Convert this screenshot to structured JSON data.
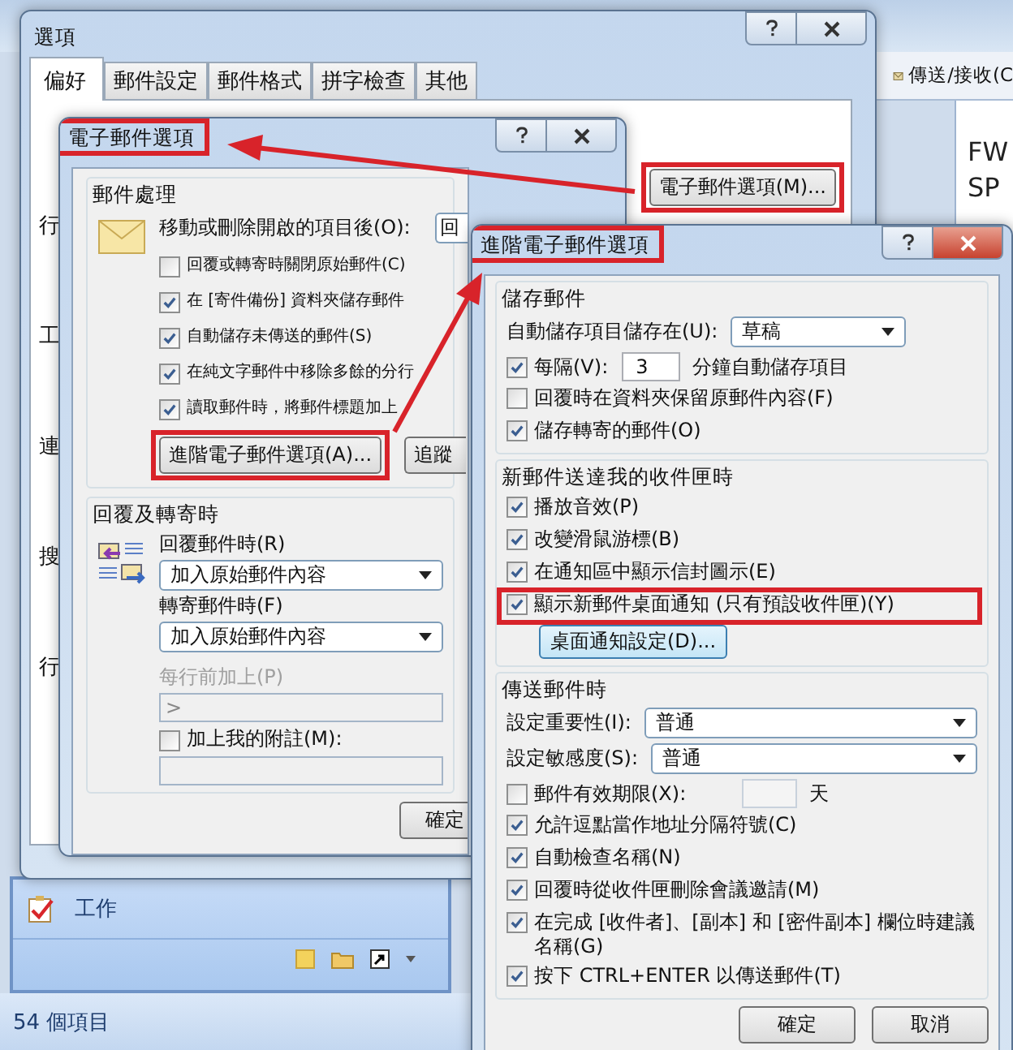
{
  "outlook": {
    "toolbar_button": "傳送/接收(C",
    "preview_lines": [
      "FW",
      "SP"
    ],
    "nav_item": "工作",
    "status_bar": "54 個項目"
  },
  "options_window": {
    "title": "選項",
    "tabs": [
      {
        "label": "偏好",
        "selected": true
      },
      {
        "label": "郵件設定",
        "selected": false
      },
      {
        "label": "郵件格式",
        "selected": false
      },
      {
        "label": "拼字檢查",
        "selected": false
      },
      {
        "label": "其他",
        "selected": false
      }
    ],
    "cut_labels": [
      "行",
      "工",
      "連",
      "搜",
      "行"
    ],
    "email_options_button": {
      "label": "電子郵件選項(M)...",
      "highlighted": true
    }
  },
  "email_options": {
    "title": {
      "text": "電子郵件選項",
      "highlighted": true
    },
    "handling": {
      "heading": "郵件處理",
      "move_label": "移動或刪除開啟的項目後(O):",
      "move_value": "回",
      "checkboxes": [
        {
          "label": "回覆或轉寄時關閉原始郵件(C)",
          "checked": false
        },
        {
          "label": "在 [寄件備份] 資料夾儲存郵件",
          "checked": true
        },
        {
          "label": "自動儲存未傳送的郵件(S)",
          "checked": true
        },
        {
          "label": "在純文字郵件中移除多餘的分行",
          "checked": true
        },
        {
          "label": "讀取郵件時，將郵件標題加上",
          "checked": true
        }
      ],
      "buttons": [
        {
          "label": "進階電子郵件選項(A)...",
          "highlighted": true
        },
        {
          "label": "追蹤",
          "highlighted": false
        }
      ]
    },
    "reply_forward": {
      "heading": "回覆及轉寄時",
      "reply_label": "回覆郵件時(R)",
      "reply_value": "加入原始郵件內容",
      "forward_label": "轉寄郵件時(F)",
      "forward_value": "加入原始郵件內容",
      "prefix_label": "每行前加上(P)",
      "prefix_disabled": true,
      "prefix_value": ">",
      "comment": {
        "label": "加上我的附註(M):",
        "checked": false
      }
    },
    "ok": "確定"
  },
  "advanced": {
    "title": {
      "text": "進階電子郵件選項",
      "highlighted": true
    },
    "sections": [
      {
        "heading": "儲存郵件",
        "rows": [
          {
            "kind": "select",
            "label": "自動儲存項目儲存在(U):",
            "value": "草稿",
            "highlighted": false
          },
          {
            "kind": "interval",
            "label": "每隔(V):",
            "value": "3",
            "suffix": "分鐘自動儲存項目",
            "checked": true,
            "highlighted": false
          },
          {
            "kind": "checkbox",
            "label": "回覆時在資料夾保留原郵件內容(F)",
            "checked": false,
            "highlighted": false
          },
          {
            "kind": "checkbox",
            "label": "儲存轉寄的郵件(O)",
            "checked": true,
            "highlighted": false
          }
        ]
      },
      {
        "heading": "新郵件送達我的收件匣時",
        "rows": [
          {
            "kind": "checkbox",
            "label": "播放音效(P)",
            "checked": true,
            "highlighted": false
          },
          {
            "kind": "checkbox",
            "label": "改變滑鼠游標(B)",
            "checked": true,
            "highlighted": false
          },
          {
            "kind": "checkbox",
            "label": "在通知區中顯示信封圖示(E)",
            "checked": true,
            "highlighted": false
          },
          {
            "kind": "checkbox",
            "label": "顯示新郵件桌面通知 (只有預設收件匣)(Y)",
            "checked": true,
            "highlighted": true
          },
          {
            "kind": "button",
            "label": "桌面通知設定(D)...",
            "highlighted": false
          }
        ]
      },
      {
        "heading": "傳送郵件時",
        "rows": [
          {
            "kind": "select",
            "label": "設定重要性(I):",
            "value": "普通",
            "highlighted": false
          },
          {
            "kind": "select",
            "label": "設定敏感度(S):",
            "value": "普通",
            "highlighted": false
          },
          {
            "kind": "expiry",
            "label": "郵件有效期限(X):",
            "suffix": "天",
            "checked": false,
            "highlighted": false
          },
          {
            "kind": "checkbox",
            "label": "允許逗點當作地址分隔符號(C)",
            "checked": true,
            "highlighted": false
          },
          {
            "kind": "checkbox",
            "label": "自動檢查名稱(N)",
            "checked": true,
            "highlighted": false
          },
          {
            "kind": "checkbox",
            "label": "回覆時從收件匣刪除會議邀請(M)",
            "checked": true,
            "highlighted": false
          },
          {
            "kind": "checkbox",
            "label": "在完成 [收件者]、[副本] 和 [密件副本] 欄位時建議名稱(G)",
            "checked": true,
            "highlighted": false
          },
          {
            "kind": "checkbox",
            "label": "按下 CTRL+ENTER 以傳送郵件(T)",
            "checked": true,
            "highlighted": false
          }
        ]
      }
    ],
    "buttons": [
      "確定",
      "取消"
    ]
  }
}
